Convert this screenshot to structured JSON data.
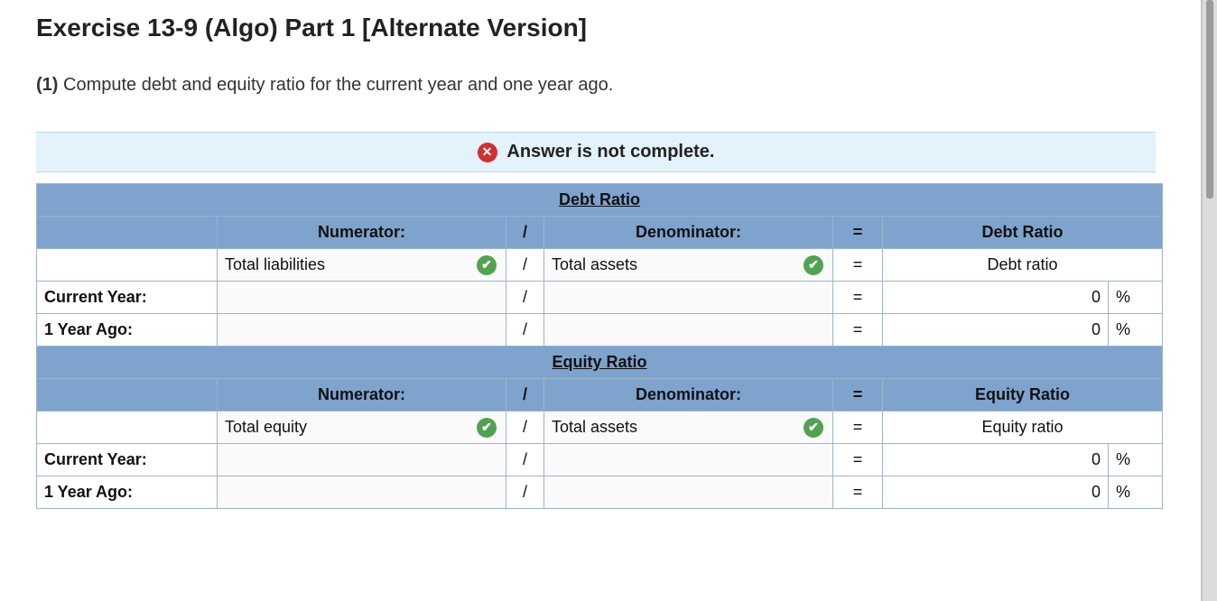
{
  "title": "Exercise 13-9 (Algo) Part 1 [Alternate Version]",
  "instruction_prefix": "(1)",
  "instruction_text": "Compute debt and equity ratio for the current year and one year ago.",
  "status_message": "Answer is not complete.",
  "sections": {
    "debt": {
      "header": "Debt Ratio",
      "sub": {
        "numerator": "Numerator:",
        "denominator": "Denominator:",
        "result": "Debt Ratio"
      },
      "formula": {
        "numerator": "Total liabilities",
        "slash": "/",
        "denominator": "Total assets",
        "eq": "=",
        "result": "Debt ratio"
      },
      "rows": [
        {
          "label": "Current Year:",
          "slash": "/",
          "eq": "=",
          "value": "0",
          "pct": "%"
        },
        {
          "label": "1 Year Ago:",
          "slash": "/",
          "eq": "=",
          "value": "0",
          "pct": "%"
        }
      ]
    },
    "equity": {
      "header": "Equity Ratio",
      "sub": {
        "numerator": "Numerator:",
        "denominator": "Denominator:",
        "result": "Equity Ratio"
      },
      "formula": {
        "numerator": "Total equity",
        "slash": "/",
        "denominator": "Total assets",
        "eq": "=",
        "result": "Equity ratio"
      },
      "rows": [
        {
          "label": "Current Year:",
          "slash": "/",
          "eq": "=",
          "value": "0",
          "pct": "%"
        },
        {
          "label": "1 Year Ago:",
          "slash": "/",
          "eq": "=",
          "value": "0",
          "pct": "%"
        }
      ]
    }
  },
  "symbols": {
    "slash": "/",
    "eq": "="
  }
}
